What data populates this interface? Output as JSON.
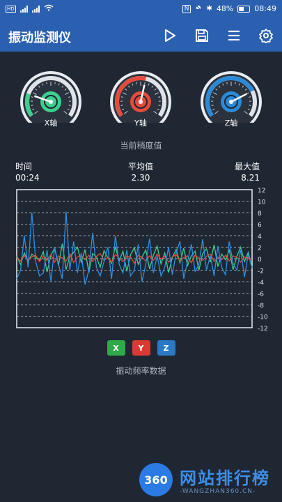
{
  "status": {
    "left_icons": [
      "sim-icon",
      "signal-icon",
      "signal-icon",
      "wifi-icon"
    ],
    "battery": "48%",
    "time": "08:49"
  },
  "appbar": {
    "title": "振动监测仪"
  },
  "gauges": [
    {
      "label": "X轴",
      "color": "#3ecf8e",
      "value_fraction": 0.22
    },
    {
      "label": "Y轴",
      "color": "#e34b3c",
      "value_fraction": 0.55
    },
    {
      "label": "Z轴",
      "color": "#2b8ad8",
      "value_fraction": 0.75
    }
  ],
  "caption_top": "当前稍度值",
  "stats": {
    "time_label": "时间",
    "time_value": "00:24",
    "avg_label": "平均值",
    "avg_value": "2.30",
    "max_label": "最大值",
    "max_value": "8.21"
  },
  "chart_data": {
    "type": "line",
    "ylim": [
      -12,
      12
    ],
    "yticks": [
      "12",
      "10",
      "8",
      "6",
      "4",
      "2",
      "0",
      "-2",
      "-4",
      "-6",
      "-8",
      "-10",
      "-12"
    ],
    "grid": true,
    "series": [
      {
        "name": "X",
        "color": "#3ecf8e",
        "values": [
          0.5,
          -1,
          1,
          -0.5,
          0.8,
          0.2,
          -0.3,
          1.2,
          -2.3,
          0.6,
          1.8,
          -1.2,
          2.6,
          -1.9,
          0.4,
          1.1,
          2,
          -0.6,
          1.6,
          -2.4,
          0.9,
          0.3,
          -1.5,
          1.4,
          0.2,
          -0.8,
          2.1,
          -0.4,
          1.3,
          -2.2,
          0.7,
          1.9,
          -1,
          0.3,
          1.5,
          -1.8,
          0.6,
          2.2,
          -0.9,
          1,
          -2.4,
          0.2,
          1.6,
          -0.7,
          1.8,
          -1.2,
          0.5,
          1.3,
          -2,
          0.9,
          1.7,
          -0.6,
          2.4,
          -1.4,
          0.8,
          -0.2,
          1.5,
          -1.9,
          0.4,
          2,
          -0.5,
          1.1,
          -1.6
        ]
      },
      {
        "name": "Y",
        "color": "#e34b3c",
        "values": [
          0.2,
          -0.4,
          0.5,
          -0.2,
          0.3,
          0.6,
          -0.5,
          0.4,
          -0.3,
          0.7,
          -0.6,
          0.5,
          0.1,
          -0.4,
          0.8,
          -0.7,
          0.3,
          0.5,
          -0.2,
          0.6,
          -0.5,
          0.4,
          0.9,
          -0.3,
          0.2,
          -0.6,
          0.7,
          0.1,
          -0.5,
          0.4,
          0.3,
          -0.8,
          0.6,
          0.2,
          -0.4,
          0.5,
          -0.3,
          0.8,
          -0.1,
          0.4,
          -0.6,
          0.3,
          0.7,
          -0.4,
          0.2,
          0.5,
          -0.7,
          0.6,
          0.1,
          -0.3,
          0.4,
          0.8,
          -0.5,
          0.3,
          -0.2,
          0.6,
          -0.4,
          0.5,
          0.2,
          -0.6,
          0.3,
          0.1,
          -0.2
        ]
      },
      {
        "name": "Z",
        "color": "#2f8fe0",
        "values": [
          -3.5,
          -2,
          4,
          -1.5,
          8,
          -0.5,
          -3,
          -2.5,
          1.5,
          -4,
          2,
          -1,
          -3.5,
          8.2,
          -2,
          3,
          -2.5,
          1,
          -4.5,
          -2,
          4.5,
          -1.5,
          -3,
          -0.5,
          2,
          -3.5,
          4,
          -1,
          -2.5,
          1.5,
          -3,
          -2,
          2.5,
          -4,
          -1,
          3.5,
          -2.5,
          0.5,
          -3,
          -1.5,
          2,
          -2.8,
          1,
          3,
          -3.5,
          -0.5,
          2.5,
          -2.2,
          -1,
          3.4,
          -2,
          0.5,
          -3,
          2.2,
          -1.5,
          -2.8,
          3,
          -0.8,
          -2,
          1.5,
          -3.2,
          0.8,
          -1.6
        ]
      }
    ]
  },
  "legend": {
    "x": "X",
    "y": "Y",
    "z": "Z"
  },
  "caption_bottom": "振动频率数据",
  "watermark": {
    "logo_text": "360",
    "title": "网站排行榜",
    "subtitle": "-WANGZHAN360.CN-"
  }
}
